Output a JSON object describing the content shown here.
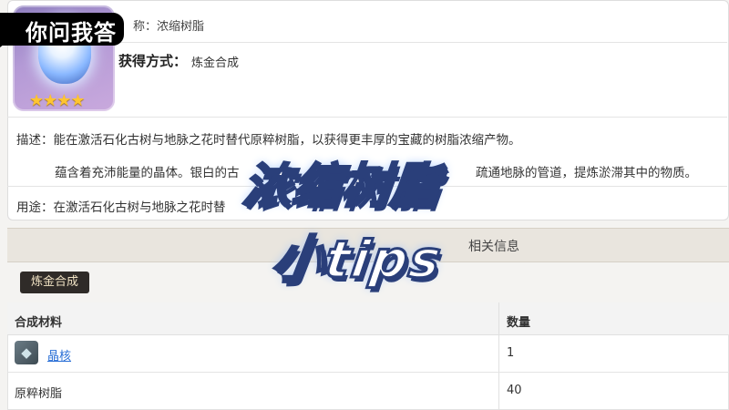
{
  "item": {
    "name_label": "称：",
    "name_value": "浓缩树脂",
    "stars": "★★★★",
    "obtain_label": "获得方式：",
    "obtain_value": "炼金合成",
    "desc_label": "描述：",
    "desc_line1": "能在激活石化古树与地脉之花时替代原粹树脂，以获得更丰厚的宝藏的树脂浓缩产物。",
    "desc_line2_left": "蕴含着充沛能量的晶体。银白的古",
    "desc_line2_right": "疏通地脉的管道，提炼淤滞其中的物质。",
    "use_label": "用途：",
    "use_value": "在激活石化古树与地脉之花时替"
  },
  "section": {
    "title": "相关信息",
    "recipe_tag": "炼金合成"
  },
  "table": {
    "headers": [
      "合成材料",
      "数量"
    ],
    "rows": [
      {
        "material": "晶核",
        "qty": "1",
        "link": true,
        "icon": "crystal-core-icon"
      },
      {
        "material": "原粹树脂",
        "qty": "40",
        "link": false
      }
    ]
  },
  "overlay": {
    "channel": "你问我答",
    "caption_main": "浓缩树脂",
    "caption_sub": "小tips"
  },
  "colors": {
    "link": "#2a6fd6",
    "tag_bg": "#2f2b28",
    "stars": "#ffc531",
    "caption_stroke": "#2a3f7a"
  }
}
